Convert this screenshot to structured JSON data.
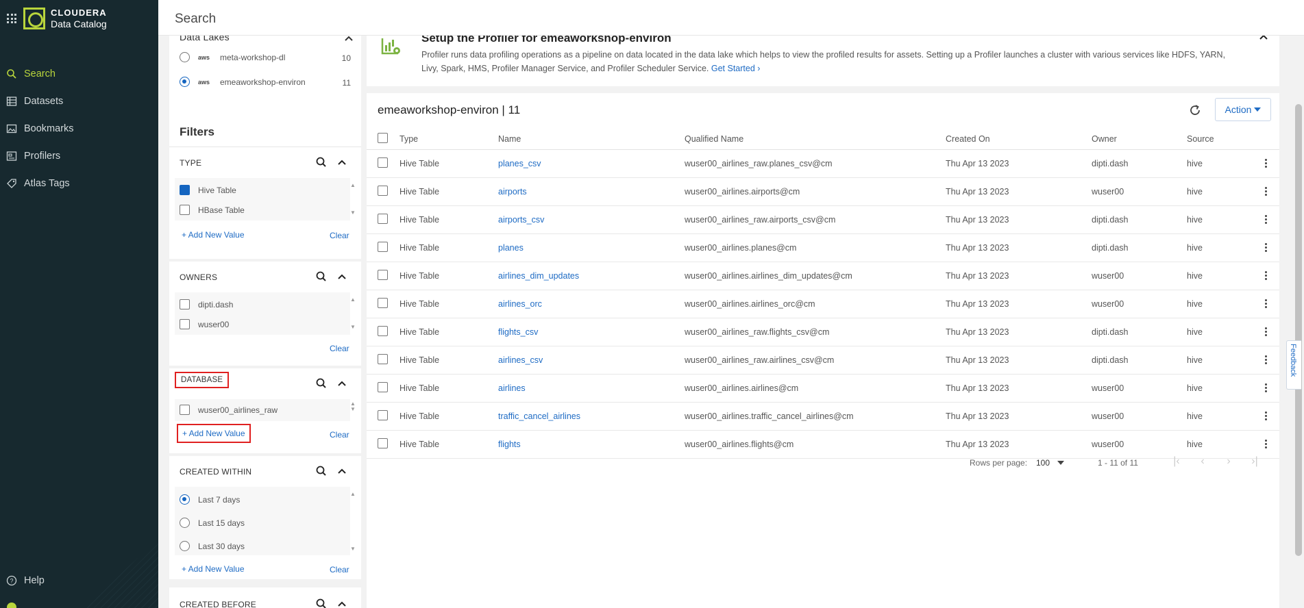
{
  "app": {
    "brand": "CLOUDERA",
    "product": "Data Catalog"
  },
  "nav": {
    "items": [
      {
        "label": "Search",
        "icon": "search-icon"
      },
      {
        "label": "Datasets",
        "icon": "datasets-icon"
      },
      {
        "label": "Bookmarks",
        "icon": "bookmarks-icon"
      },
      {
        "label": "Profilers",
        "icon": "profilers-icon"
      },
      {
        "label": "Atlas Tags",
        "icon": "tag-icon"
      }
    ],
    "help": "Help"
  },
  "header": {
    "title": "Search"
  },
  "data_lakes": {
    "title": "Data Lakes",
    "items": [
      {
        "provider": "aws",
        "name": "meta-workshop-dl",
        "count": "10",
        "selected": false
      },
      {
        "provider": "aws",
        "name": "emeaworkshop-environ",
        "count": "11",
        "selected": true
      }
    ]
  },
  "filters": {
    "title": "Filters",
    "type": {
      "title": "TYPE",
      "options": [
        "Hive Table",
        "HBase Table"
      ],
      "add": "+ Add New Value",
      "clear": "Clear"
    },
    "owners": {
      "title": "OWNERS",
      "options": [
        "dipti.dash",
        "wuser00"
      ],
      "clear": "Clear"
    },
    "database": {
      "title": "DATABASE",
      "options": [
        "wuser00_airlines_raw"
      ],
      "add": "+ Add New Value",
      "clear": "Clear"
    },
    "created_within": {
      "title": "CREATED WITHIN",
      "options": [
        "Last 7 days",
        "Last 15 days",
        "Last 30 days"
      ],
      "add": "+ Add New Value",
      "clear": "Clear"
    },
    "created_before": {
      "title": "CREATED BEFORE"
    }
  },
  "banner": {
    "title": "Setup the Profiler for emeaworkshop-environ",
    "text": "Profiler runs data profiling operations as a pipeline on data located in the data lake which helps to view the profiled results for assets. Setting up a Profiler launches a cluster with various services like HDFS, YARN, Livy, Spark, HMS, Profiler Manager Service, and Profiler Scheduler Service.",
    "link": "Get Started"
  },
  "results": {
    "title": "emeaworkshop-environ | 11",
    "action": "Action",
    "columns": [
      "Type",
      "Name",
      "Qualified Name",
      "Created On",
      "Owner",
      "Source"
    ],
    "rows": [
      {
        "type": "Hive Table",
        "name": "planes_csv",
        "qname": "wuser00_airlines_raw.planes_csv@cm",
        "created": "Thu Apr 13 2023",
        "owner": "dipti.dash",
        "source": "hive"
      },
      {
        "type": "Hive Table",
        "name": "airports",
        "qname": "wuser00_airlines.airports@cm",
        "created": "Thu Apr 13 2023",
        "owner": "wuser00",
        "source": "hive"
      },
      {
        "type": "Hive Table",
        "name": "airports_csv",
        "qname": "wuser00_airlines_raw.airports_csv@cm",
        "created": "Thu Apr 13 2023",
        "owner": "dipti.dash",
        "source": "hive"
      },
      {
        "type": "Hive Table",
        "name": "planes",
        "qname": "wuser00_airlines.planes@cm",
        "created": "Thu Apr 13 2023",
        "owner": "dipti.dash",
        "source": "hive"
      },
      {
        "type": "Hive Table",
        "name": "airlines_dim_updates",
        "qname": "wuser00_airlines.airlines_dim_updates@cm",
        "created": "Thu Apr 13 2023",
        "owner": "wuser00",
        "source": "hive"
      },
      {
        "type": "Hive Table",
        "name": "airlines_orc",
        "qname": "wuser00_airlines.airlines_orc@cm",
        "created": "Thu Apr 13 2023",
        "owner": "wuser00",
        "source": "hive"
      },
      {
        "type": "Hive Table",
        "name": "flights_csv",
        "qname": "wuser00_airlines_raw.flights_csv@cm",
        "created": "Thu Apr 13 2023",
        "owner": "dipti.dash",
        "source": "hive"
      },
      {
        "type": "Hive Table",
        "name": "airlines_csv",
        "qname": "wuser00_airlines_raw.airlines_csv@cm",
        "created": "Thu Apr 13 2023",
        "owner": "dipti.dash",
        "source": "hive"
      },
      {
        "type": "Hive Table",
        "name": "airlines",
        "qname": "wuser00_airlines.airlines@cm",
        "created": "Thu Apr 13 2023",
        "owner": "wuser00",
        "source": "hive"
      },
      {
        "type": "Hive Table",
        "name": "traffic_cancel_airlines",
        "qname": "wuser00_airlines.traffic_cancel_airlines@cm",
        "created": "Thu Apr 13 2023",
        "owner": "wuser00",
        "source": "hive"
      },
      {
        "type": "Hive Table",
        "name": "flights",
        "qname": "wuser00_airlines.flights@cm",
        "created": "Thu Apr 13 2023",
        "owner": "wuser00",
        "source": "hive"
      }
    ],
    "pager": {
      "rows_label": "Rows per page:",
      "rows_value": "100",
      "range": "1 - 11 of 11"
    }
  },
  "feedback": "Feedback",
  "colors": {
    "sidebar": "#17292f",
    "accent": "#b9d53c",
    "link": "#1e6bc4",
    "highlight": "#e02020"
  }
}
